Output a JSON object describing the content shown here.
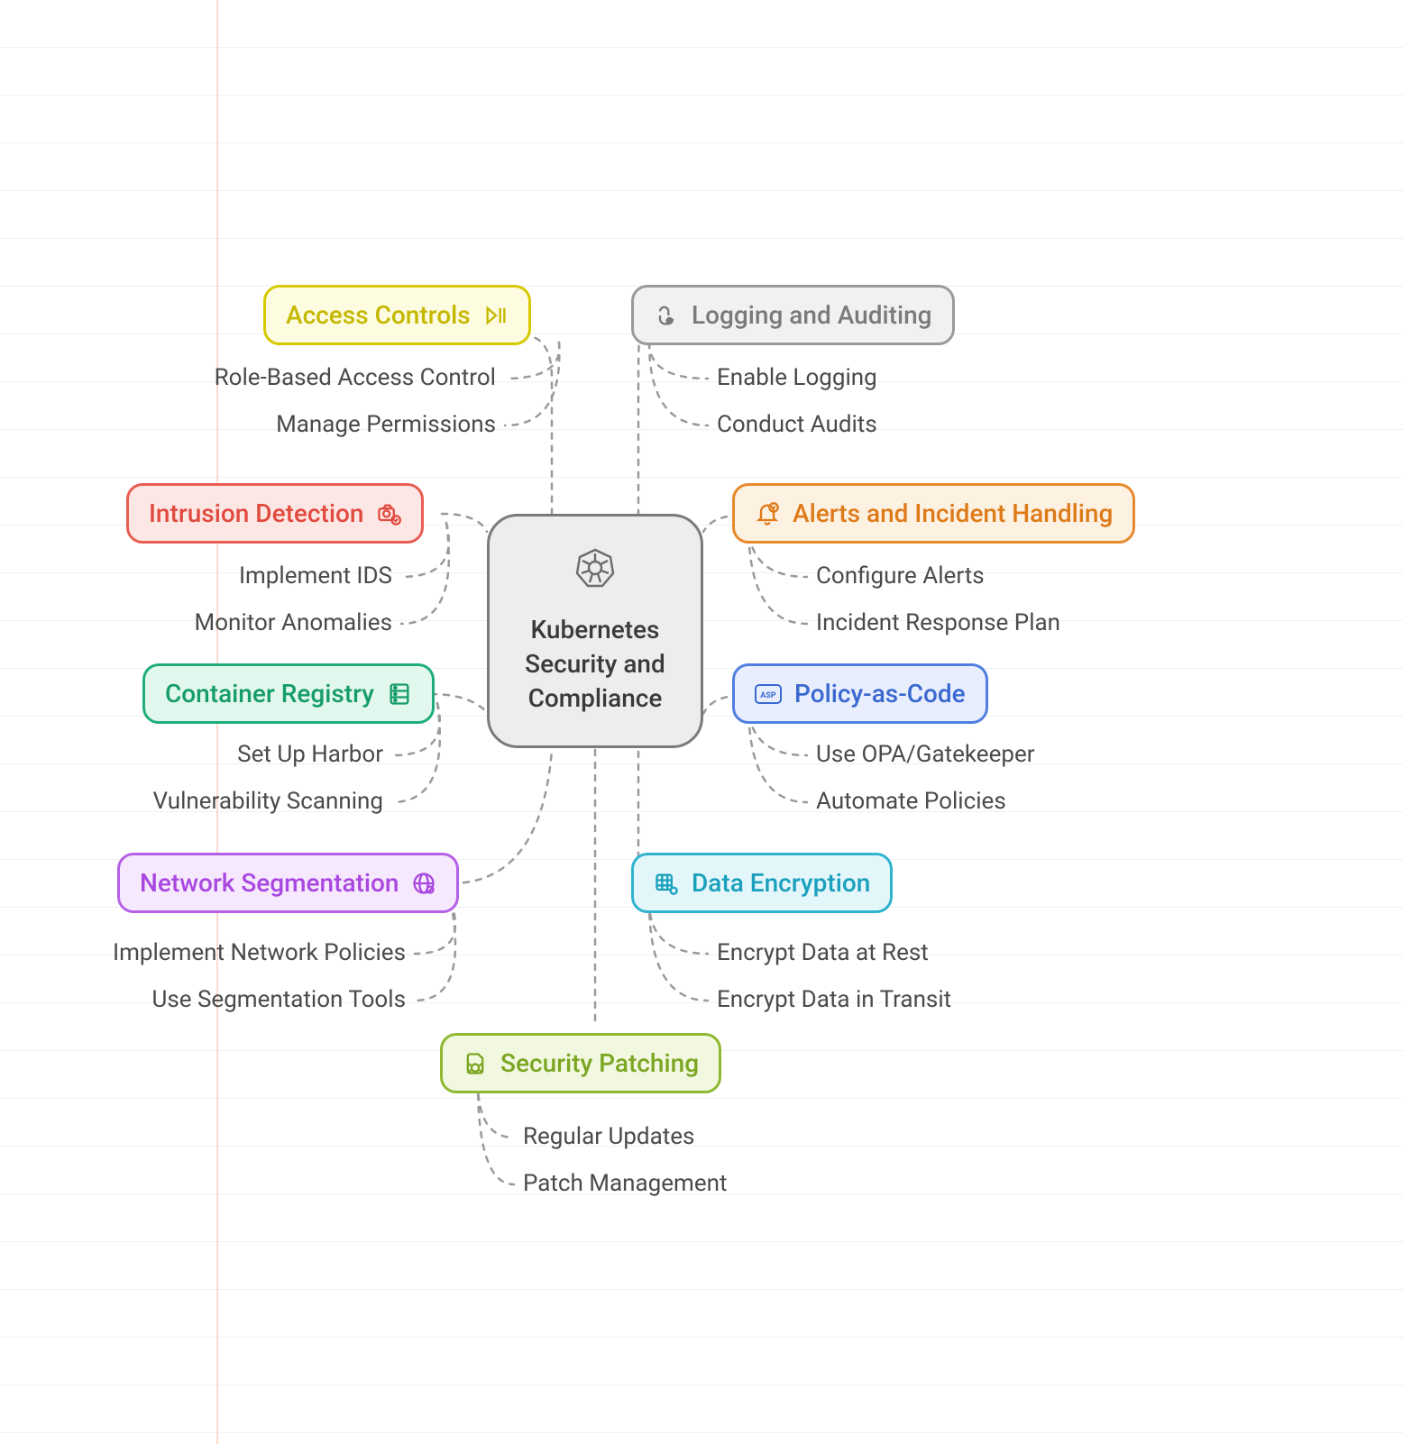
{
  "central": {
    "title": "Kubernetes Security and Compliance",
    "icon": "kubernetes-wheel"
  },
  "branches": {
    "access_controls": {
      "label": "Access Controls",
      "icon": "play-pause",
      "color": "#d7c900",
      "bg": "#fdfbe0",
      "children": [
        "Role-Based Access Control",
        "Manage Permissions"
      ]
    },
    "intrusion_detection": {
      "label": "Intrusion Detection",
      "icon": "camera-check",
      "color": "#e85d52",
      "bg": "#fde7e5",
      "children": [
        "Implement IDS",
        "Monitor Anomalies"
      ]
    },
    "container_registry": {
      "label": "Container Registry",
      "icon": "server-rack",
      "color": "#1fae7a",
      "bg": "#e2f7ee",
      "children": [
        "Set Up Harbor",
        "Vulnerability Scanning"
      ]
    },
    "network_segmentation": {
      "label": "Network Segmentation",
      "icon": "globe-cog",
      "color": "#b560e6",
      "bg": "#f6e9fe",
      "children": [
        "Implement Network Policies",
        "Use Segmentation Tools"
      ]
    },
    "logging_auditing": {
      "label": "Logging and Auditing",
      "icon": "eye-hand",
      "color": "#8a8a8a",
      "bg": "#f1f1f1",
      "children": [
        "Enable Logging",
        "Conduct Audits"
      ]
    },
    "alerts_incident": {
      "label": "Alerts and Incident Handling",
      "icon": "bell-check",
      "color": "#e78a2e",
      "bg": "#fdf1e2",
      "children": [
        "Configure Alerts",
        "Incident Response Plan"
      ]
    },
    "policy_as_code": {
      "label": "Policy-as-Code",
      "icon": "asp-badge",
      "color": "#4f7fe0",
      "bg": "#e8eefd",
      "children": [
        "Use OPA/Gatekeeper",
        "Automate Policies"
      ]
    },
    "data_encryption": {
      "label": "Data Encryption",
      "icon": "grid-lock",
      "color": "#2fb3cf",
      "bg": "#e3f7fb",
      "children": [
        "Encrypt Data at Rest",
        "Encrypt Data in Transit"
      ]
    },
    "security_patching": {
      "label": "Security Patching",
      "icon": "file-bug",
      "color": "#8fb82f",
      "bg": "#f2f8e0",
      "children": [
        "Regular Updates",
        "Patch Management"
      ]
    }
  }
}
